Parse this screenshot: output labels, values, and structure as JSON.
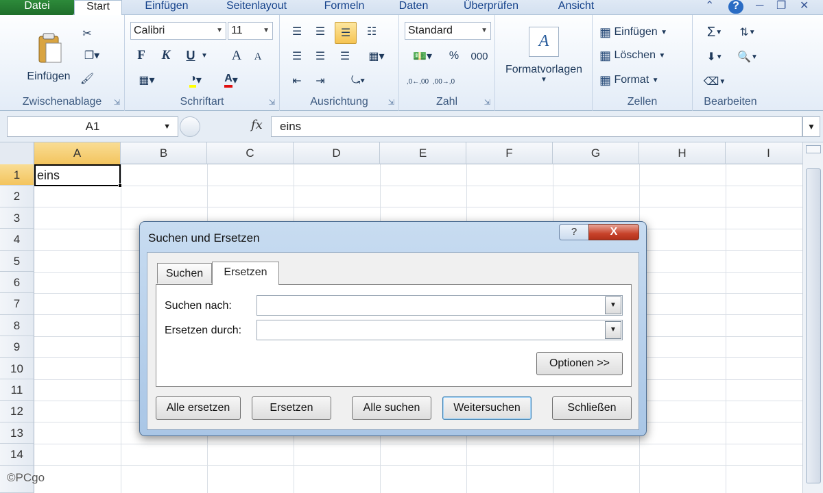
{
  "tabs": [
    "Datei",
    "Start",
    "Einfügen",
    "Seitenlayout",
    "Formeln",
    "Daten",
    "Überprüfen",
    "Ansicht"
  ],
  "ribbon": {
    "clipboard": {
      "label": "Zwischenablage",
      "paste": "Einfügen"
    },
    "font": {
      "label": "Schriftart",
      "name": "Calibri",
      "size": "11",
      "bold": "F",
      "italic": "K",
      "underline": "U",
      "grow": "A",
      "shrink": "A"
    },
    "alignment": {
      "label": "Ausrichtung"
    },
    "number": {
      "label": "Zahl",
      "format": "Standard",
      "percent": "%",
      "thousands": "000",
      "inc_decimal": ",0←,00",
      "dec_decimal": ",00→,0"
    },
    "styles": {
      "label": "Formatvorlagen"
    },
    "cells": {
      "label": "Zellen",
      "insert": "Einfügen",
      "delete": "Löschen",
      "format": "Format"
    },
    "editing": {
      "label": "Bearbeiten"
    }
  },
  "formula_bar": {
    "name_box": "A1",
    "fx": "fx",
    "content": "eins"
  },
  "columns": [
    "A",
    "B",
    "C",
    "D",
    "E",
    "F",
    "G",
    "H",
    "I"
  ],
  "rows": [
    "1",
    "2",
    "3",
    "4",
    "5",
    "6",
    "7",
    "8",
    "9",
    "10",
    "11",
    "12",
    "13",
    "14"
  ],
  "cells": {
    "A1": "eins"
  },
  "dialog": {
    "title": "Suchen und Ersetzen",
    "help": "?",
    "close": "X",
    "tabs": {
      "search": "Suchen",
      "replace": "Ersetzen"
    },
    "find_label": "Suchen nach:",
    "replace_label": "Ersetzen durch:",
    "find_value": "",
    "replace_value": "",
    "options_button": "Optionen >>",
    "buttons": {
      "replace_all": "Alle ersetzen",
      "replace": "Ersetzen",
      "find_all": "Alle suchen",
      "find_next": "Weitersuchen",
      "close": "Schließen"
    }
  },
  "watermark": "©PCgo"
}
